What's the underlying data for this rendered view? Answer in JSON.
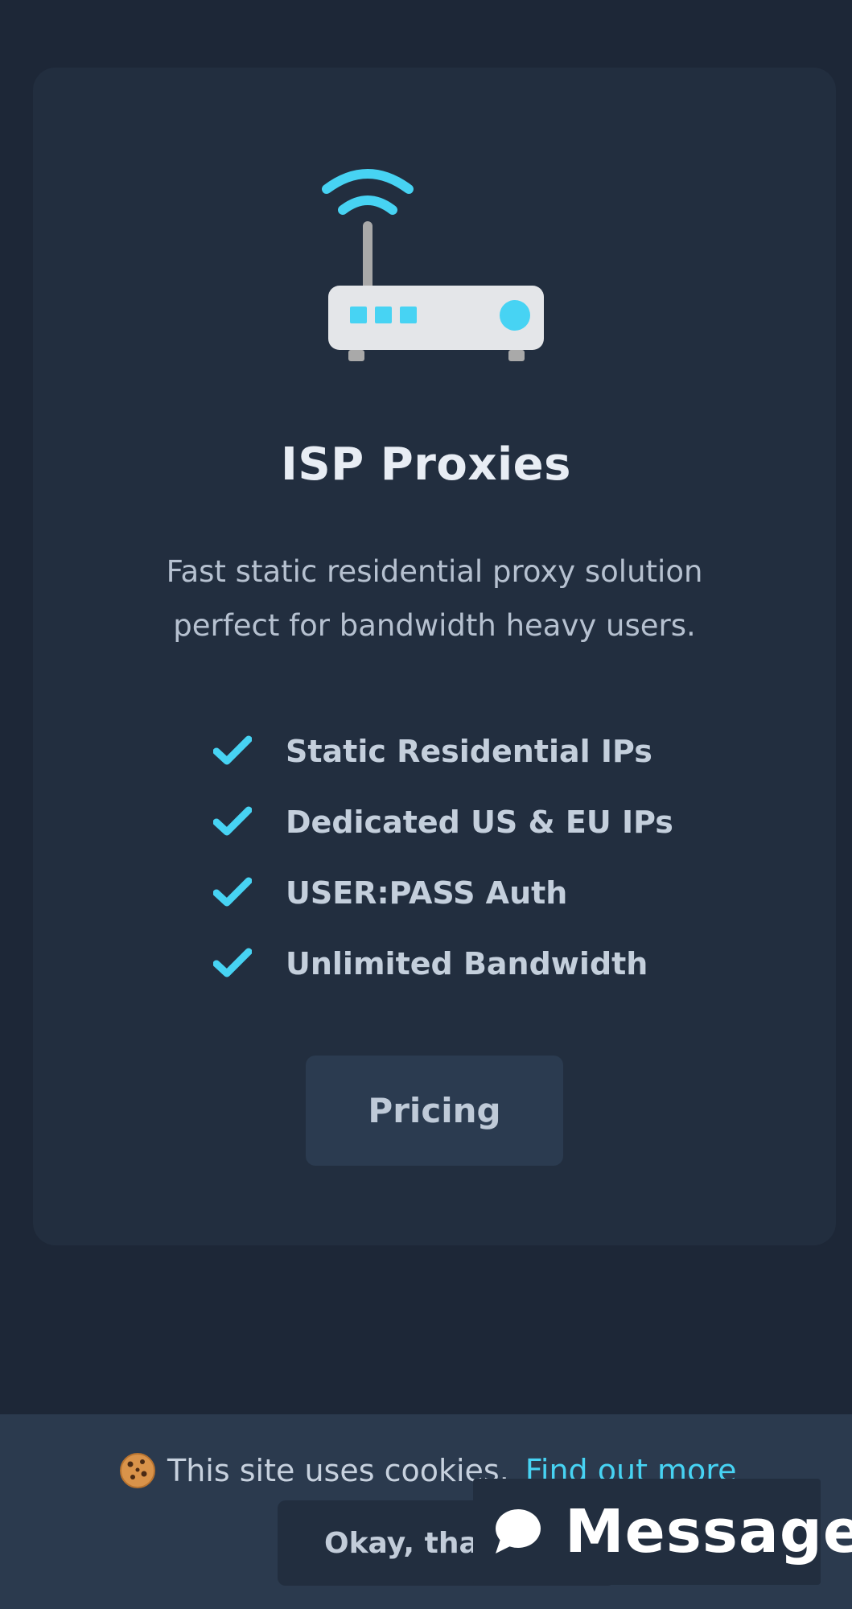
{
  "product": {
    "title": "ISP Proxies",
    "description": "Fast static residential proxy solution perfect for bandwidth heavy users.",
    "features": [
      "Static Residential IPs",
      "Dedicated US & EU IPs",
      "USER:PASS Auth",
      "Unlimited Bandwidth"
    ],
    "cta_label": "Pricing",
    "icon": "router-icon"
  },
  "cookie_banner": {
    "text": "This site uses cookies.",
    "link_label": "Find out more",
    "accept_label": "Okay, thanks"
  },
  "chat_widget": {
    "label": "Message",
    "icon": "chat-icon"
  },
  "colors": {
    "background": "#1d2737",
    "card": "#222e3f",
    "accent": "#47d3f3",
    "button": "#2b3b50",
    "cookie_bar": "#2b3a4e"
  }
}
